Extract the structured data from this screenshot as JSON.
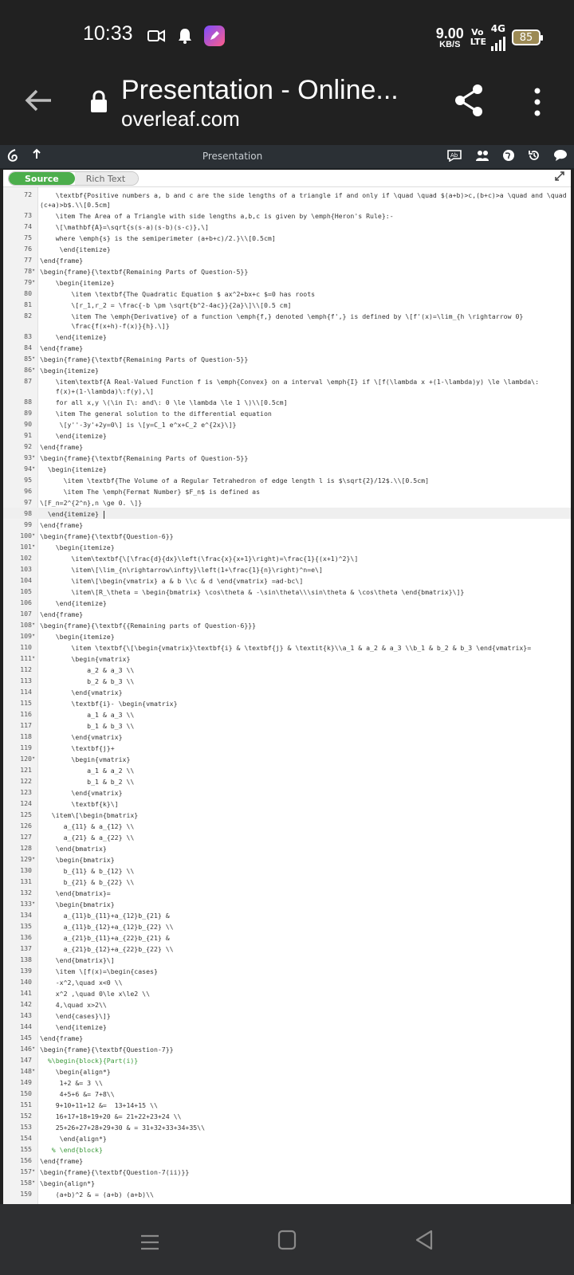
{
  "status": {
    "time": "10:33",
    "speed_value": "9.00",
    "speed_unit": "KB/S",
    "volte_top": "Vo",
    "volte_bottom": "LTE",
    "network": "4G",
    "battery": "85"
  },
  "browser": {
    "title": "Presentation - Online...",
    "url": "overleaf.com"
  },
  "overleaf": {
    "project_title": "Presentation",
    "mode_source": "Source",
    "mode_rich": "Rich Text"
  },
  "editor": {
    "active_line": "98",
    "lines": [
      {
        "n": "72",
        "f": "",
        "t": "    \\textbf{Positive numbers a, b and c are the side lengths of a triangle if and only if \\quad \\quad $(a+b)>c,(b+c)>a \\quad and \\quad (c+a)>b$.\\\\[0.5cm]",
        "wrap": true
      },
      {
        "n": "73",
        "f": "",
        "t": "    \\item The Area of a Triangle with side lengths a,b,c is given by \\emph{Heron's Rule}:-"
      },
      {
        "n": "74",
        "f": "",
        "t": "    \\[\\mathbf{A}=\\sqrt{s(s-a)(s-b)(s-c)},\\]"
      },
      {
        "n": "75",
        "f": "",
        "t": "    where \\emph{s} is the semiperimeter (a+b+c)/2.}\\\\[0.5cm]"
      },
      {
        "n": "76",
        "f": "",
        "t": "     \\end{itemize}"
      },
      {
        "n": "77",
        "f": "",
        "t": "\\end{frame}"
      },
      {
        "n": "78",
        "f": "▾",
        "t": "\\begin{frame}{\\textbf{Remaining Parts of Question-5}}"
      },
      {
        "n": "79",
        "f": "▾",
        "t": "    \\begin{itemize}"
      },
      {
        "n": "80",
        "f": "",
        "t": "        \\item \\textbf{The Quadratic Equation $ ax^2+bx+c $=0 has roots"
      },
      {
        "n": "81",
        "f": "",
        "t": "        \\[r_1,r_2 = \\frac{-b \\pm \\sqrt{b^2-4ac}}{2a}\\]\\\\[0.5 cm]"
      },
      {
        "n": "82",
        "f": "",
        "t": "        \\item The \\emph{Derivative} of a function \\emph{f,} denoted \\emph{f',} is defined by \\[f'(x)=\\lim_{h \\rightarrow 0}\n        \\frac{f(x+h)-f(x)}{h}.\\]}",
        "wrap": true
      },
      {
        "n": "83",
        "f": "",
        "t": "    \\end{itemize}"
      },
      {
        "n": "84",
        "f": "",
        "t": "\\end{frame}"
      },
      {
        "n": "85",
        "f": "▾",
        "t": "\\begin{frame}{\\textbf{Remaining Parts of Question-5}}"
      },
      {
        "n": "86",
        "f": "▾",
        "t": "\\begin{itemize}"
      },
      {
        "n": "87",
        "f": "",
        "t": "    \\item\\textbf{A Real-Valued Function f is \\emph{Convex} on a interval \\emph{I} if \\[f(\\lambda x +(1-\\lambda)y) \\le \\lambda\\:\n    f(x)+(1-\\lambda)\\:f(y),\\]",
        "wrap": true
      },
      {
        "n": "88",
        "f": "",
        "t": "    for all x,y \\(\\in I\\: and\\: 0 \\le \\lambda \\le 1 \\)\\\\[0.5cm]"
      },
      {
        "n": "89",
        "f": "",
        "t": "    \\item The general solution to the differential equation"
      },
      {
        "n": "90",
        "f": "",
        "t": "     \\[y''-3y'+2y=0\\] is \\[y=C_1 e^x+C_2 e^{2x}\\]}"
      },
      {
        "n": "91",
        "f": "",
        "t": "    \\end{itemize}"
      },
      {
        "n": "92",
        "f": "",
        "t": "\\end{frame}"
      },
      {
        "n": "93",
        "f": "▾",
        "t": "\\begin{frame}{\\textbf{Remaining Parts of Question-5}}"
      },
      {
        "n": "94",
        "f": "▾",
        "t": "  \\begin{itemize}"
      },
      {
        "n": "95",
        "f": "",
        "t": "      \\item \\textbf{The Volume of a Regular Tetrahedron of edge length l is $\\sqrt{2}/12$.\\\\[0.5cm]"
      },
      {
        "n": "96",
        "f": "",
        "t": "      \\item The \\emph{Fermat Number} $F_n$ is defined as"
      },
      {
        "n": "97",
        "f": "",
        "t": "\\[F_n=2^{2^n},n \\ge 0. \\]}"
      },
      {
        "n": "98",
        "f": "",
        "t": "  \\end{itemize}"
      },
      {
        "n": "99",
        "f": "",
        "t": "\\end{frame}"
      },
      {
        "n": "100",
        "f": "▾",
        "t": "\\begin{frame}{\\textbf{Question-6}}"
      },
      {
        "n": "101",
        "f": "▾",
        "t": "    \\begin{itemize}"
      },
      {
        "n": "102",
        "f": "",
        "t": "        \\item\\textbf{\\[\\frac{d}{dx}\\left(\\frac{x}{x+1}\\right)=\\frac{1}{(x+1)^2}\\]"
      },
      {
        "n": "103",
        "f": "",
        "t": "        \\item\\[\\lim_{n\\rightarrow\\infty}\\left(1+\\frac{1}{n}\\right)^n=e\\]"
      },
      {
        "n": "104",
        "f": "",
        "t": "        \\item\\[\\begin{vmatrix} a & b \\\\c & d \\end{vmatrix} =ad-bc\\]"
      },
      {
        "n": "105",
        "f": "",
        "t": "        \\item\\[R_\\theta = \\begin{bmatrix} \\cos\\theta & -\\sin\\theta\\\\\\sin\\theta & \\cos\\theta \\end{bmatrix}\\]}"
      },
      {
        "n": "106",
        "f": "",
        "t": "    \\end{itemize}"
      },
      {
        "n": "107",
        "f": "",
        "t": "\\end{frame}"
      },
      {
        "n": "108",
        "f": "▾",
        "t": "\\begin{frame}{\\textbf{{Remaining parts of Question-6}}}"
      },
      {
        "n": "109",
        "f": "▾",
        "t": "    \\begin{itemize}"
      },
      {
        "n": "110",
        "f": "",
        "t": "        \\item \\textbf{\\[\\begin{vmatrix}\\textbf{i} & \\textbf{j} & \\textit{k}\\\\a_1 & a_2 & a_3 \\\\b_1 & b_2 & b_3 \\end{vmatrix}="
      },
      {
        "n": "111",
        "f": "▾",
        "t": "        \\begin{vmatrix}"
      },
      {
        "n": "112",
        "f": "",
        "t": "            a_2 & a_3 \\\\"
      },
      {
        "n": "113",
        "f": "",
        "t": "            b_2 & b_3 \\\\"
      },
      {
        "n": "114",
        "f": "",
        "t": "        \\end{vmatrix}"
      },
      {
        "n": "115",
        "f": "",
        "t": "        \\textbf{i}- \\begin{vmatrix}"
      },
      {
        "n": "116",
        "f": "",
        "t": "            a_1 & a_3 \\\\"
      },
      {
        "n": "117",
        "f": "",
        "t": "            b_1 & b_3 \\\\"
      },
      {
        "n": "118",
        "f": "",
        "t": "        \\end{vmatrix}"
      },
      {
        "n": "119",
        "f": "",
        "t": "        \\textbf{j}+"
      },
      {
        "n": "120",
        "f": "▾",
        "t": "        \\begin{vmatrix}"
      },
      {
        "n": "121",
        "f": "",
        "t": "            a_1 & a_2 \\\\"
      },
      {
        "n": "122",
        "f": "",
        "t": "            b_1 & b_2 \\\\"
      },
      {
        "n": "123",
        "f": "",
        "t": "        \\end{vmatrix}"
      },
      {
        "n": "124",
        "f": "",
        "t": "        \\textbf{k}\\]"
      },
      {
        "n": "125",
        "f": "",
        "t": "   \\item\\[\\begin{bmatrix}"
      },
      {
        "n": "126",
        "f": "",
        "t": "      a_{11} & a_{12} \\\\"
      },
      {
        "n": "127",
        "f": "",
        "t": "      a_{21} & a_{22} \\\\"
      },
      {
        "n": "128",
        "f": "",
        "t": "    \\end{bmatrix}"
      },
      {
        "n": "129",
        "f": "▾",
        "t": "    \\begin{bmatrix}"
      },
      {
        "n": "130",
        "f": "",
        "t": "      b_{11} & b_{12} \\\\"
      },
      {
        "n": "131",
        "f": "",
        "t": "      b_{21} & b_{22} \\\\"
      },
      {
        "n": "132",
        "f": "",
        "t": "    \\end{bmatrix}="
      },
      {
        "n": "133",
        "f": "▾",
        "t": "    \\begin{bmatrix}"
      },
      {
        "n": "134",
        "f": "",
        "t": "      a_{11}b_{11}+a_{12}b_{21} &"
      },
      {
        "n": "135",
        "f": "",
        "t": "      a_{11}b_{12}+a_{12}b_{22} \\\\"
      },
      {
        "n": "136",
        "f": "",
        "t": "      a_{21}b_{11}+a_{22}b_{21} &"
      },
      {
        "n": "137",
        "f": "",
        "t": "      a_{21}b_{12}+a_{22}b_{22} \\\\"
      },
      {
        "n": "138",
        "f": "",
        "t": "    \\end{bmatrix}\\]"
      },
      {
        "n": "139",
        "f": "",
        "t": "    \\item \\[f(x)=\\begin{cases}"
      },
      {
        "n": "140",
        "f": "",
        "t": "    -x^2,\\quad x<0 \\\\"
      },
      {
        "n": "141",
        "f": "",
        "t": "    x^2 ,\\quad 0\\le x\\le2 \\\\"
      },
      {
        "n": "142",
        "f": "",
        "t": "    4,\\quad x>2\\\\"
      },
      {
        "n": "143",
        "f": "",
        "t": "    \\end{cases}\\]}"
      },
      {
        "n": "144",
        "f": "",
        "t": "    \\end{itemize}"
      },
      {
        "n": "145",
        "f": "",
        "t": "\\end{frame}"
      },
      {
        "n": "146",
        "f": "▾",
        "t": "\\begin{frame}{\\textbf{Question-7}}"
      },
      {
        "n": "147",
        "f": "",
        "t": "  %\\begin{block}{Part(i)}"
      },
      {
        "n": "148",
        "f": "▾",
        "t": "    \\begin{align*}"
      },
      {
        "n": "149",
        "f": "",
        "t": "     1+2 &= 3 \\\\"
      },
      {
        "n": "150",
        "f": "",
        "t": "     4+5+6 &= 7+8\\\\"
      },
      {
        "n": "151",
        "f": "",
        "t": "    9+10+11+12 &=  13+14+15 \\\\"
      },
      {
        "n": "152",
        "f": "",
        "t": "    16+17+18+19+20 &= 21+22+23+24 \\\\"
      },
      {
        "n": "153",
        "f": "",
        "t": "    25+26+27+28+29+30 & = 31+32+33+34+35\\\\"
      },
      {
        "n": "154",
        "f": "",
        "t": "     \\end{align*}"
      },
      {
        "n": "155",
        "f": "",
        "t": "   % \\end{block}"
      },
      {
        "n": "156",
        "f": "",
        "t": "\\end{frame}"
      },
      {
        "n": "157",
        "f": "▾",
        "t": "\\begin{frame}{\\textbf{Question-7(ii)}}"
      },
      {
        "n": "158",
        "f": "▾",
        "t": "\\begin{align*}"
      },
      {
        "n": "159",
        "f": "",
        "t": "    (a+b)^2 & = (a+b) (a+b)\\\\"
      }
    ]
  }
}
